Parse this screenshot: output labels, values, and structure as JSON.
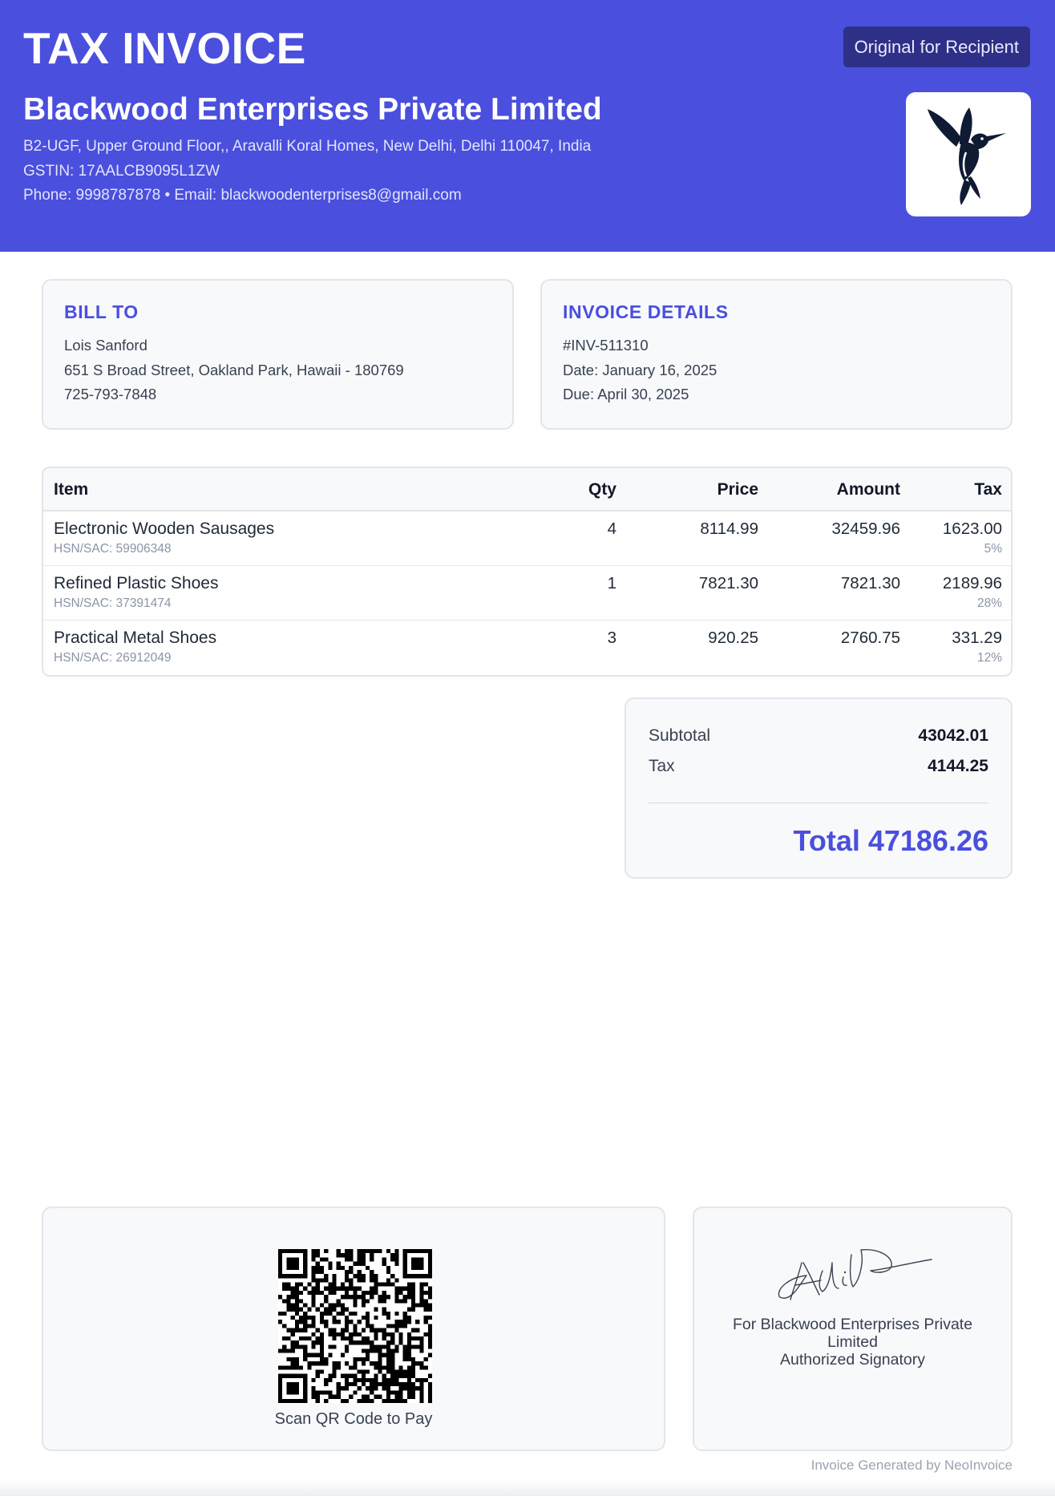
{
  "header": {
    "title": "TAX INVOICE",
    "copy_label": "Original for Recipient",
    "company_name": "Blackwood Enterprises Private Limited",
    "address": "B2-UGF, Upper Ground Floor,, Aravalli Koral Homes, New Delhi, Delhi 110047, India",
    "gstin": "GSTIN: 17AALCB9095L1ZW",
    "contact": "Phone: 9998787878 • Email: blackwoodenterprises8@gmail.com",
    "logo_icon": "hummingbird-logo-icon"
  },
  "bill_to": {
    "heading": "BILL TO",
    "name": "Lois Sanford",
    "address": "651 S Broad Street, Oakland Park, Hawaii - 180769",
    "phone": "725-793-7848"
  },
  "invoice_details": {
    "heading": "INVOICE DETAILS",
    "number": "#INV-511310",
    "date": "Date: January 16, 2025",
    "due": "Due: April 30, 2025"
  },
  "table": {
    "headers": {
      "item": "Item",
      "qty": "Qty",
      "price": "Price",
      "amount": "Amount",
      "tax": "Tax"
    },
    "rows": [
      {
        "name": "Electronic Wooden Sausages",
        "hsn": "HSN/SAC: 59906348",
        "qty": "4",
        "price": "8114.99",
        "amount": "32459.96",
        "tax": "1623.00",
        "rate": "5%"
      },
      {
        "name": "Refined Plastic Shoes",
        "hsn": "HSN/SAC: 37391474",
        "qty": "1",
        "price": "7821.30",
        "amount": "7821.30",
        "tax": "2189.96",
        "rate": "28%"
      },
      {
        "name": "Practical Metal Shoes",
        "hsn": "HSN/SAC: 26912049",
        "qty": "3",
        "price": "920.25",
        "amount": "2760.75",
        "tax": "331.29",
        "rate": "12%"
      }
    ]
  },
  "totals": {
    "subtotal_label": "Subtotal",
    "subtotal_value": "43042.01",
    "tax_label": "Tax",
    "tax_value": "4144.25",
    "total": "Total 47186.26"
  },
  "payment": {
    "qr_icon": "qr-code-icon",
    "caption": "Scan QR Code to Pay"
  },
  "signature": {
    "line1": "For Blackwood Enterprises Private Limited",
    "line2": "Authorized Signatory"
  },
  "footer": {
    "generated_by": "Invoice Generated by NeoInvoice"
  },
  "colors": {
    "accent": "#4a4fdd",
    "badge": "#2e3087",
    "card_bg": "#f8f9fb",
    "border": "#e2e5ea"
  }
}
